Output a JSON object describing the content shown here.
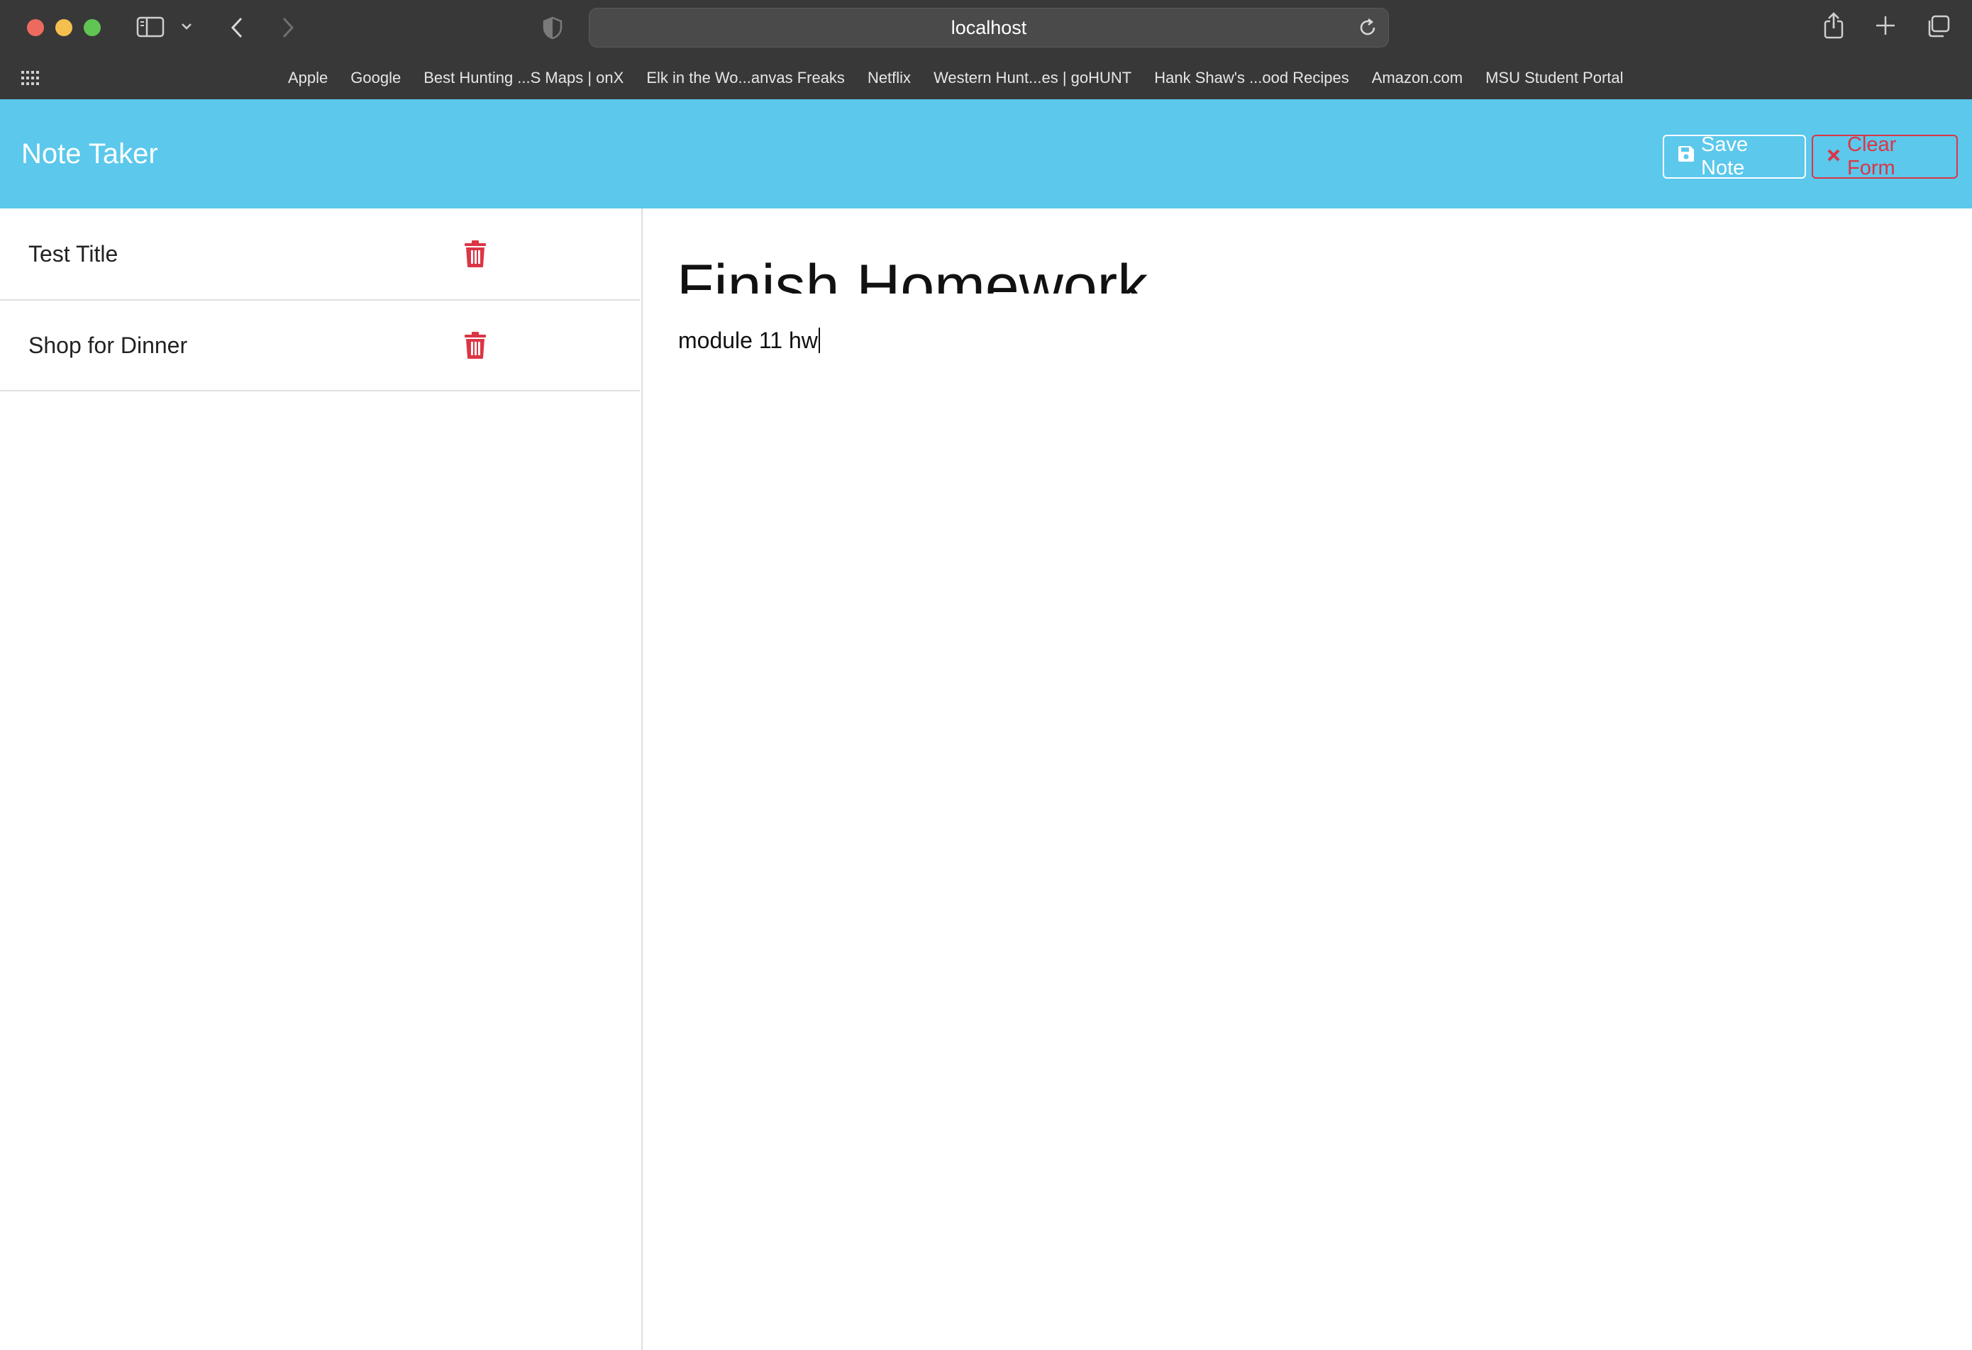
{
  "browser": {
    "url": "localhost",
    "bookmarks": [
      "Apple",
      "Google",
      "Best Hunting ...S Maps | onX",
      "Elk in the Wo...anvas Freaks",
      "Netflix",
      "Western Hunt...es | goHUNT",
      "Hank Shaw's ...ood Recipes",
      "Amazon.com",
      "MSU Student Portal"
    ],
    "icons": [
      "sidebar-icon",
      "chevron-down-icon",
      "back-icon",
      "forward-icon",
      "shield-icon",
      "reload-icon",
      "share-icon",
      "new-tab-icon",
      "tab-overview-icon",
      "grid-icon"
    ]
  },
  "app": {
    "brand": "Note Taker",
    "save_label": "Save Note",
    "clear_label": "Clear Form",
    "colors": {
      "navbar": "#5bc8ec",
      "danger": "#dc3545"
    }
  },
  "notes": [
    {
      "title": "Test Title"
    },
    {
      "title": "Shop for Dinner"
    }
  ],
  "editor": {
    "title": "Finish Homework",
    "text": "module 11 hw"
  }
}
